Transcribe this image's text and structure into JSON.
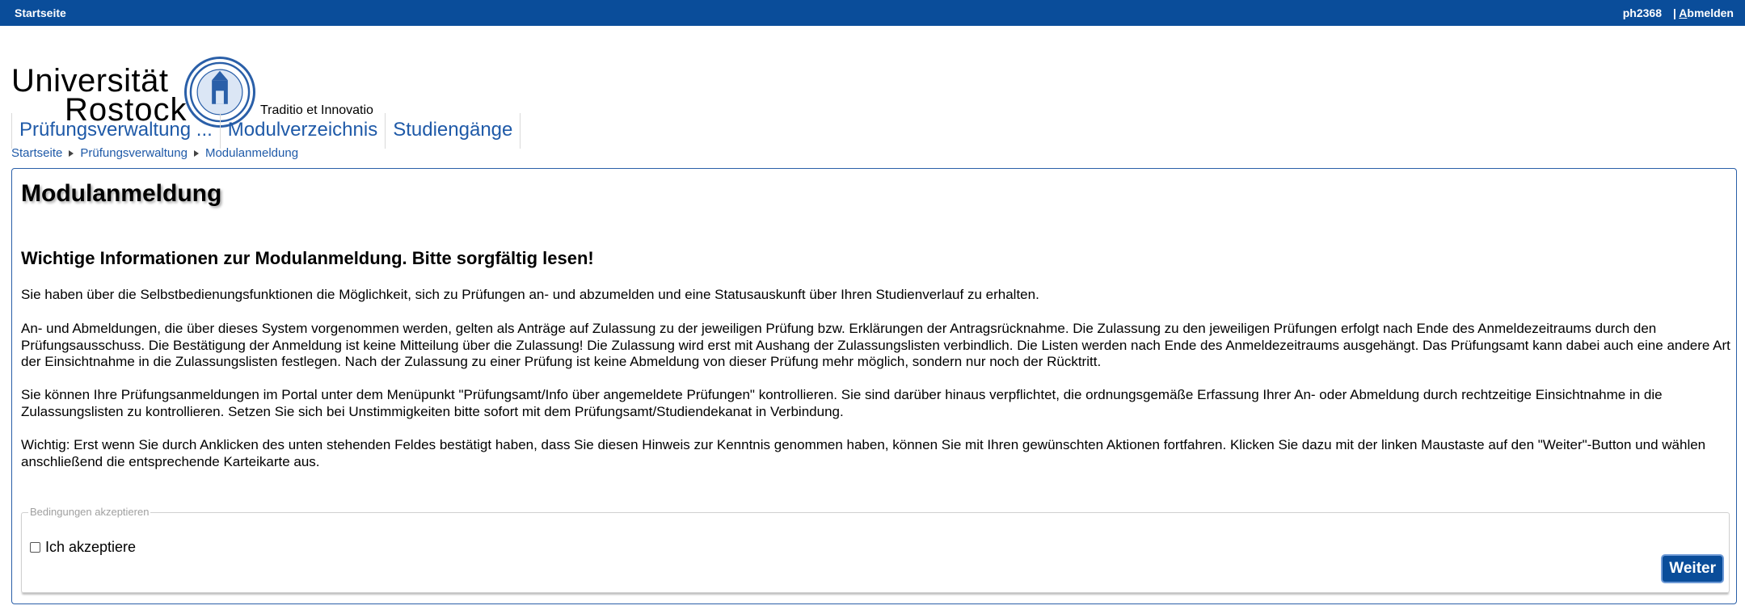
{
  "topbar": {
    "home_link": "Startseite",
    "user": "ph2368",
    "separator": "|",
    "logout_first": "A",
    "logout_rest": "bmelden"
  },
  "logo": {
    "line1": "Universität",
    "line2": "Rostock",
    "motto": "Traditio et Innovatio"
  },
  "nav": {
    "tabs": [
      {
        "label": "Prüfungsverwaltung ..."
      },
      {
        "label": "Modulverzeichnis"
      },
      {
        "label": "Studiengänge"
      }
    ]
  },
  "breadcrumb": [
    "Startseite",
    "Prüfungsverwaltung",
    "Modulanmeldung"
  ],
  "main": {
    "title": "Modulanmeldung",
    "subtitle": "Wichtige Informationen zur Modulanmeldung. Bitte sorgfältig lesen!",
    "paragraphs": [
      "Sie haben über die Selbstbedienungsfunktionen die Möglichkeit, sich zu Prüfungen an- und abzumelden und eine Statusauskunft über Ihren Studienverlauf zu erhalten.",
      "An- und Abmeldungen, die über dieses System vorgenommen werden, gelten als Anträge auf Zulassung zu der jeweiligen Prüfung bzw. Erklärungen der Antragsrücknahme. Die Zulassung zu den jeweiligen Prüfungen erfolgt nach Ende des Anmeldezeitraums durch den Prüfungsausschuss. Die Bestätigung der Anmeldung ist keine Mitteilung über die Zulassung! Die Zulassung wird erst mit Aushang der Zulassungslisten verbindlich. Die Listen werden nach Ende des Anmeldezeitraums ausgehängt. Das Prüfungsamt kann dabei auch eine andere Art der Einsichtnahme in die Zulassungslisten festlegen. Nach der Zulassung zu einer Prüfung ist keine Abmeldung von dieser Prüfung mehr möglich, sondern nur noch der Rücktritt.",
      "Sie können Ihre Prüfungsanmeldungen im Portal unter dem Menüpunkt \"Prüfungsamt/Info über angemeldete Prüfungen\" kontrollieren. Sie sind darüber hinaus verpflichtet, die ordnungsgemäße Erfassung Ihrer An- oder Abmeldung durch rechtzeitige Einsichtnahme in die Zulassungslisten zu kontrollieren. Setzen Sie sich bei Unstimmigkeiten bitte sofort mit dem Prüfungsamt/Studiendekanat in Verbindung.",
      "Wichtig: Erst wenn Sie durch Anklicken des unten stehenden Feldes bestätigt haben, dass Sie diesen Hinweis zur Kenntnis genommen haben, können Sie mit Ihren gewünschten Aktionen fortfahren. Klicken Sie dazu mit der linken Maustaste auf den \"Weiter\"-Button und wählen anschließend die entsprechende Karteikarte aus."
    ],
    "fieldset_legend": "Bedingungen akzeptieren",
    "checkbox_label": "Ich akzeptiere",
    "checkbox_checked": false,
    "submit_label": "Weiter"
  },
  "colors": {
    "brand_blue": "#0a4d9a",
    "link_blue": "#1f5aa8"
  }
}
